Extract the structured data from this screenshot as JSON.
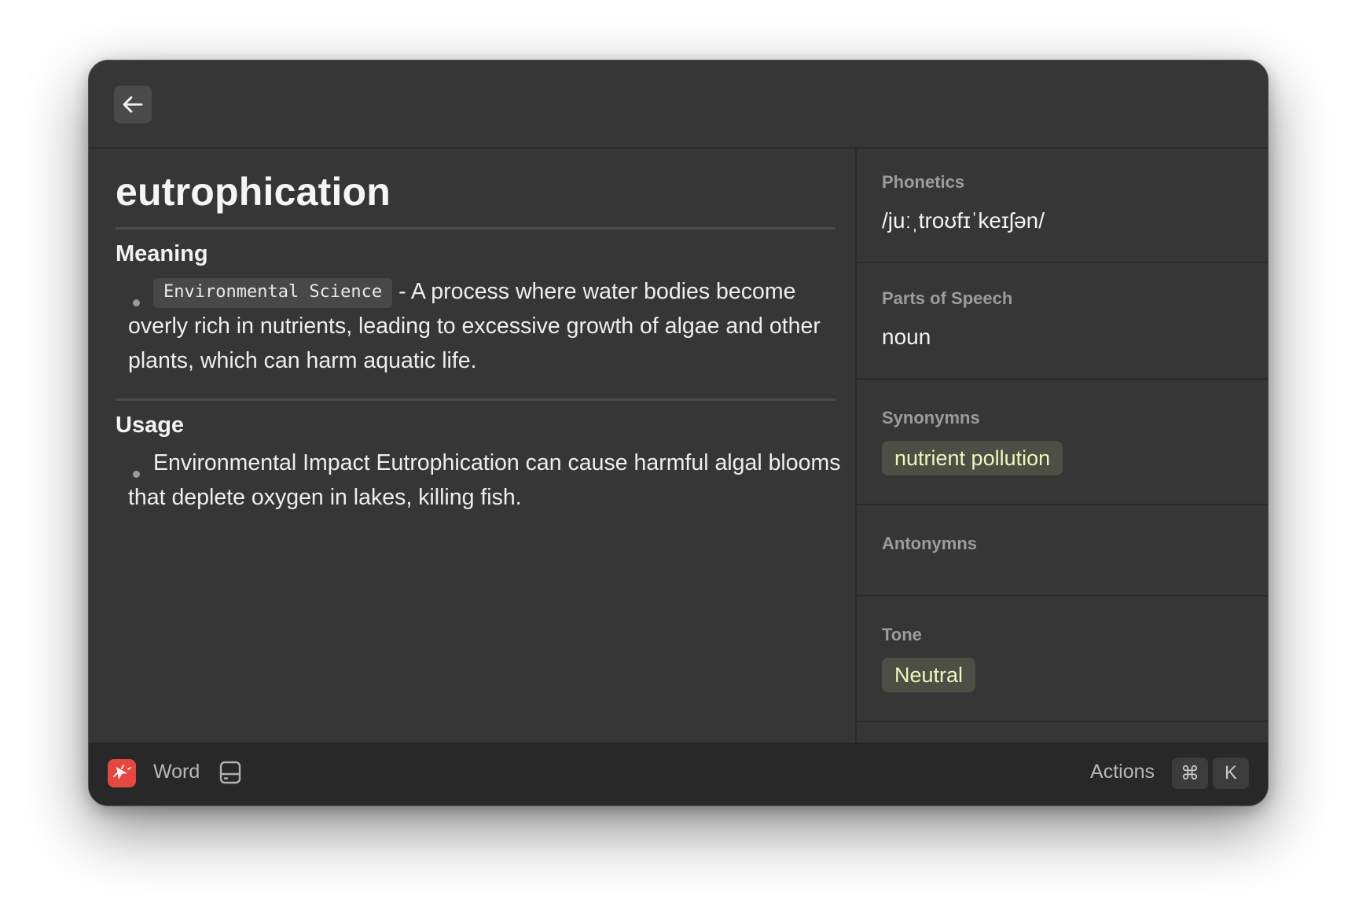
{
  "entry": {
    "word": "eutrophication"
  },
  "meaning": {
    "heading": "Meaning",
    "items": [
      {
        "tag": "Environmental Science",
        "text": " - A process where water bodies become overly rich in nutrients, leading to excessive growth of algae and other plants, which can harm aquatic life."
      }
    ]
  },
  "usage": {
    "heading": "Usage",
    "items": [
      {
        "text": "Environmental Impact Eutrophication can cause harmful algal blooms that deplete oxygen in lakes, killing fish."
      }
    ]
  },
  "sidebar": {
    "phonetics": {
      "label": "Phonetics",
      "value": "/juːˌtroʊfɪˈkeɪʃən/"
    },
    "parts_of_speech": {
      "label": "Parts of Speech",
      "value": "noun"
    },
    "synonyms": {
      "label": "Synonymns",
      "chips": [
        "nutrient pollution"
      ]
    },
    "antonyms": {
      "label": "Antonymns",
      "chips": []
    },
    "tone": {
      "label": "Tone",
      "chips": [
        "Neutral"
      ]
    }
  },
  "footer": {
    "app_name": "Word",
    "actions_label": "Actions",
    "shortcut_keys": [
      "⌘",
      "K"
    ]
  },
  "icons": {
    "back": "arrow-left-icon",
    "app": "app-logo-icon",
    "panel": "panel-bottom-icon"
  },
  "colors": {
    "window_bg": "#363636",
    "footer_bg": "#282828",
    "chip_bg": "#4d4f44",
    "chip_text": "#eff5c0",
    "app_logo": "#e5483f"
  }
}
